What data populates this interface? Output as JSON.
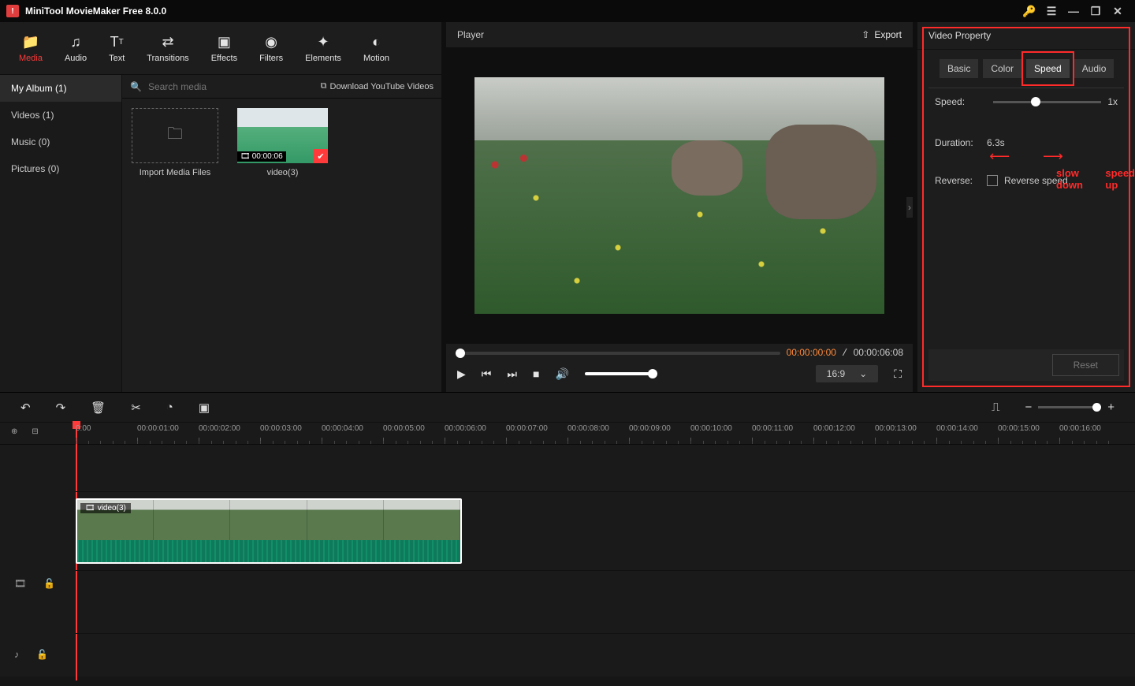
{
  "app": {
    "title": "MiniTool MovieMaker Free 8.0.0"
  },
  "topTabs": [
    {
      "label": "Media",
      "icon": "folder-icon"
    },
    {
      "label": "Audio",
      "icon": "music-icon"
    },
    {
      "label": "Text",
      "icon": "text-icon"
    },
    {
      "label": "Transitions",
      "icon": "transitions-icon"
    },
    {
      "label": "Effects",
      "icon": "effects-icon"
    },
    {
      "label": "Filters",
      "icon": "filters-icon"
    },
    {
      "label": "Elements",
      "icon": "elements-icon"
    },
    {
      "label": "Motion",
      "icon": "motion-icon"
    }
  ],
  "sidebar": {
    "items": [
      {
        "label": "My Album (1)"
      },
      {
        "label": "Videos (1)"
      },
      {
        "label": "Music (0)"
      },
      {
        "label": "Pictures (0)"
      }
    ]
  },
  "mediaLib": {
    "searchPlaceholder": "Search media",
    "download": "Download YouTube Videos",
    "importLabel": "Import Media Files",
    "clipName": "video(3)",
    "clipDuration": "00:00:06"
  },
  "player": {
    "title": "Player",
    "export": "Export",
    "currentTime": "00:00:00:00",
    "totalTime": "00:00:06:08",
    "ratio": "16:9"
  },
  "property": {
    "title": "Video Property",
    "tabs": [
      "Basic",
      "Color",
      "Speed",
      "Audio"
    ],
    "activeTab": "Speed",
    "speedLabel": "Speed:",
    "speedValue": "1x",
    "durationLabel": "Duration:",
    "durationValue": "6.3s",
    "reverseLabel": "Reverse:",
    "reverseCheck": "Reverse speed",
    "reset": "Reset",
    "annSlow": "slow down",
    "annFast": "speed up"
  },
  "timeline": {
    "clipLabel": "video(3)",
    "ticks": [
      "0:00",
      "00:00:01:00",
      "00:00:02:00",
      "00:00:03:00",
      "00:00:04:00",
      "00:00:05:00",
      "00:00:06:00",
      "00:00:07:00",
      "00:00:08:00",
      "00:00:09:00",
      "00:00:10:00",
      "00:00:11:00",
      "00:00:12:00",
      "00:00:13:00",
      "00:00:14:00",
      "00:00:15:00",
      "00:00:16:00"
    ]
  }
}
